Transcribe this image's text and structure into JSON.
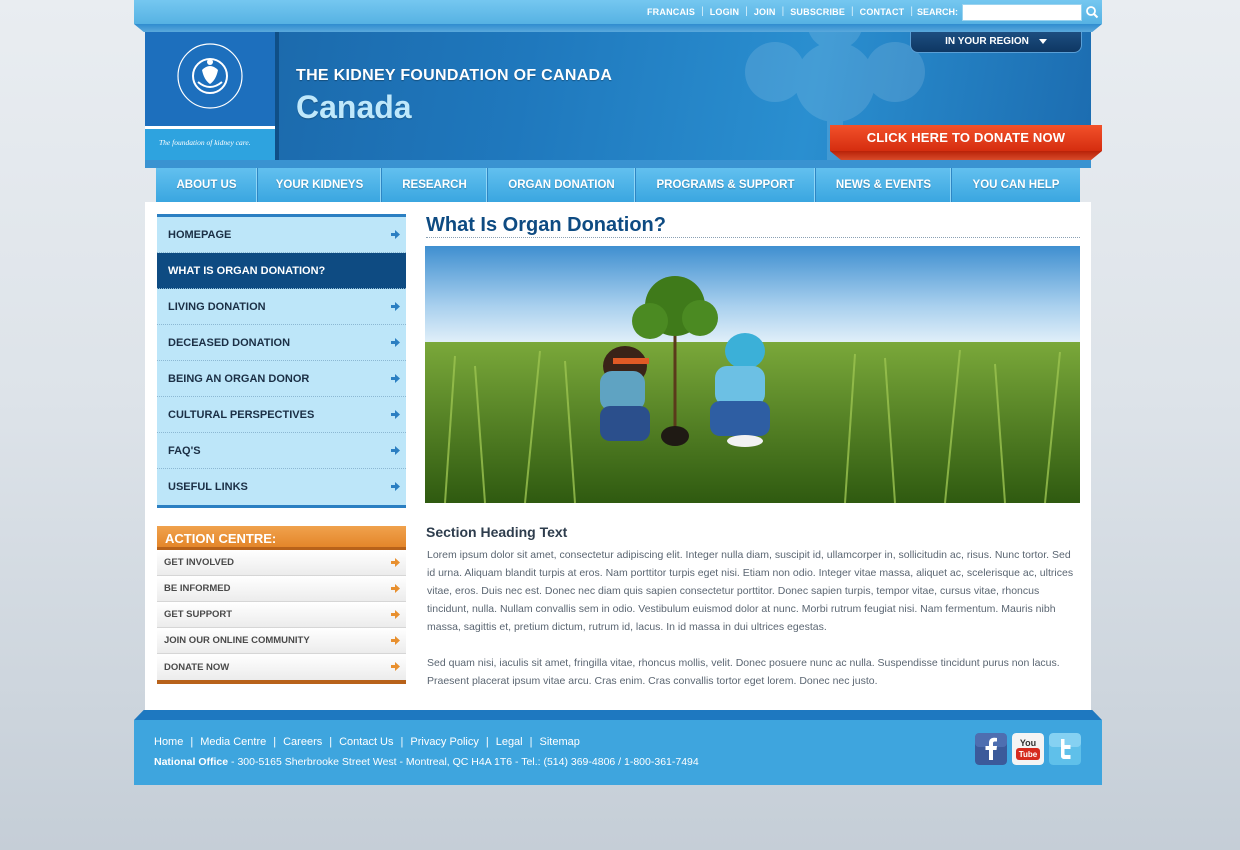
{
  "topbar": {
    "links": [
      "FRANCAIS",
      "LOGIN",
      "JOIN",
      "SUBSCRIBE",
      "CONTACT"
    ],
    "search_label": "SEARCH:",
    "search_value": ""
  },
  "header": {
    "logo_alt": "THE KIDNEY FOUNDATION OF CANADA",
    "tagline": "The foundation of kidney care.",
    "org_title": "THE KIDNEY FOUNDATION OF CANADA",
    "org_sub": "Canada",
    "region_label": "IN YOUR REGION",
    "donate_label": "CLICK HERE TO DONATE NOW"
  },
  "nav": {
    "items": [
      "ABOUT US",
      "YOUR KIDNEYS",
      "RESEARCH",
      "ORGAN DONATION",
      "PROGRAMS & SUPPORT",
      "NEWS & EVENTS",
      "YOU CAN HELP"
    ]
  },
  "sidebar": {
    "items": [
      {
        "label": "HOMEPAGE",
        "active": false
      },
      {
        "label": "WHAT IS ORGAN DONATION?",
        "active": true
      },
      {
        "label": "LIVING DONATION",
        "active": false
      },
      {
        "label": "DECEASED DONATION",
        "active": false
      },
      {
        "label": "BEING AN ORGAN DONOR",
        "active": false
      },
      {
        "label": "CULTURAL PERSPECTIVES",
        "active": false
      },
      {
        "label": "FAQ'S",
        "active": false
      },
      {
        "label": "USEFUL LINKS",
        "active": false
      }
    ]
  },
  "action": {
    "heading": "ACTION CENTRE:",
    "items": [
      "GET INVOLVED",
      "BE INFORMED",
      "GET SUPPORT",
      "JOIN OUR ONLINE COMMUNITY",
      "DONATE NOW"
    ]
  },
  "main": {
    "title": "What Is Organ Donation?",
    "section_heading": "Section Heading Text",
    "paragraphs": [
      "Lorem ipsum dolor sit amet, consectetur adipiscing elit. Integer nulla diam, suscipit id, ullamcorper in, sollicitudin ac, risus. Nunc tortor. Sed id urna. Aliquam blandit turpis at eros. Nam porttitor turpis eget nisi. Etiam non odio. Integer vitae massa, aliquet ac, scelerisque ac, ultrices vitae, eros. Duis nec est. Donec nec diam quis sapien consectetur porttitor. Donec sapien turpis, tempor vitae, cursus vitae, rhoncus tincidunt, nulla. Nullam convallis sem in odio. Vestibulum euismod dolor at nunc. Morbi rutrum feugiat nisi. Nam fermentum. Mauris nibh massa, sagittis et, pretium dictum, rutrum id, lacus. In id massa in dui ultrices egestas.",
      "Sed quam nisi, iaculis sit amet, fringilla vitae, rhoncus mollis, velit. Donec posuere nunc ac nulla. Suspendisse tincidunt purus non lacus. Praesent placerat ipsum vitae arcu. Cras enim. Cras convallis tortor eget lorem. Donec nec justo."
    ]
  },
  "footer": {
    "links": [
      "Home",
      "Media Centre",
      "Careers",
      "Contact Us",
      "Privacy Policy",
      "Legal",
      "Sitemap"
    ],
    "office_label": "National Office",
    "office_address": " - 300-5165 Sherbrooke Street West - Montreal, QC H4A 1T6 - Tel.: (514) 369-4806 / 1-800-361-7494",
    "social": [
      "facebook-icon",
      "youtube-icon",
      "twitter-icon"
    ]
  },
  "colors": {
    "brand_blue": "#1d6fbd",
    "light_blue": "#3ea5de",
    "active_nav": "#0e4b82",
    "donate_red": "#e03a18",
    "action_orange": "#e8902f"
  }
}
